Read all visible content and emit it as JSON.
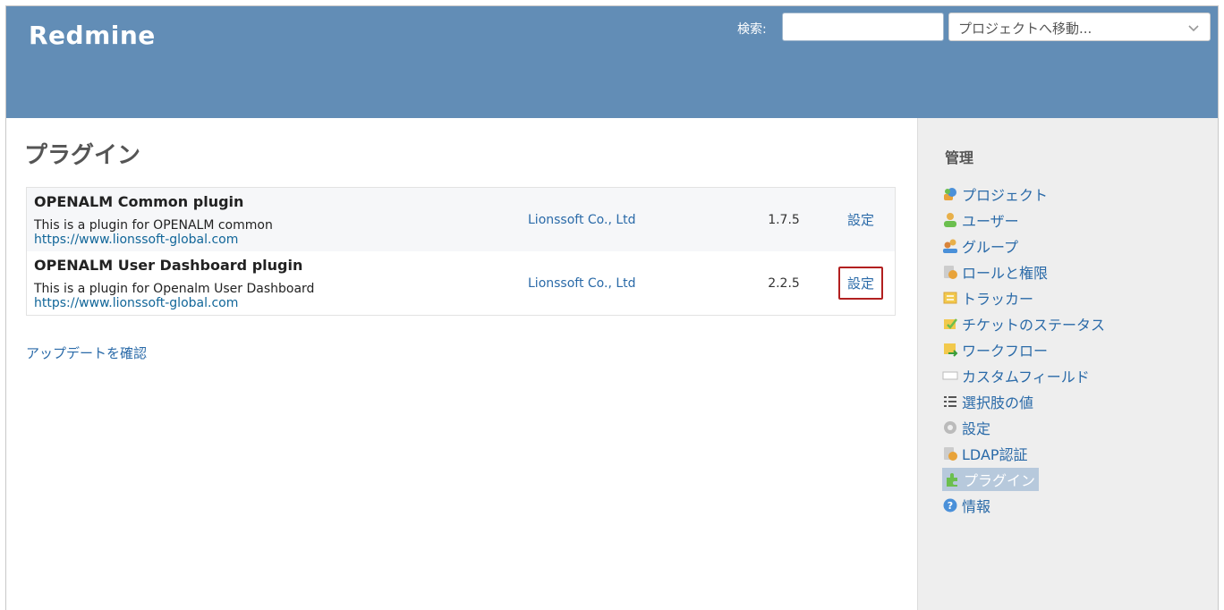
{
  "header": {
    "app_name": "Redmine",
    "search_label": "検索:",
    "search_value": "",
    "project_jump": "プロジェクトへ移動..."
  },
  "main": {
    "title": "プラグイン",
    "plugins": [
      {
        "name": "OPENALM Common plugin",
        "description": "This is a plugin for OPENALM common",
        "url": "https://www.lionssoft-global.com",
        "author": "Lionssoft Co., Ltd",
        "version": "1.7.5",
        "config_label": "設定"
      },
      {
        "name": "OPENALM User Dashboard plugin",
        "description": "This is a plugin for Openalm User Dashboard",
        "url": "https://www.lionssoft-global.com",
        "author": "Lionssoft Co., Ltd",
        "version": "2.2.5",
        "config_label": "設定"
      }
    ],
    "check_updates": "アップデートを確認"
  },
  "sidebar": {
    "title": "管理",
    "items": [
      {
        "label": "プロジェクト",
        "icon": "projects-icon"
      },
      {
        "label": "ユーザー",
        "icon": "user-icon"
      },
      {
        "label": "グループ",
        "icon": "group-icon"
      },
      {
        "label": "ロールと権限",
        "icon": "roles-icon"
      },
      {
        "label": "トラッカー",
        "icon": "tracker-icon"
      },
      {
        "label": "チケットのステータス",
        "icon": "issue-status-icon"
      },
      {
        "label": "ワークフロー",
        "icon": "workflow-icon"
      },
      {
        "label": "カスタムフィールド",
        "icon": "custom-field-icon"
      },
      {
        "label": "選択肢の値",
        "icon": "list-icon"
      },
      {
        "label": "設定",
        "icon": "settings-icon"
      },
      {
        "label": "LDAP認証",
        "icon": "ldap-icon"
      },
      {
        "label": "プラグイン",
        "icon": "plugin-icon",
        "selected": true
      },
      {
        "label": "情報",
        "icon": "info-icon"
      }
    ]
  },
  "colors": {
    "header_bg": "#628DB6",
    "link": "#2a6aa8",
    "highlight_border": "#b22020",
    "sidebar_bg": "#eeeeee",
    "selected_bg": "#b7c9dc"
  }
}
